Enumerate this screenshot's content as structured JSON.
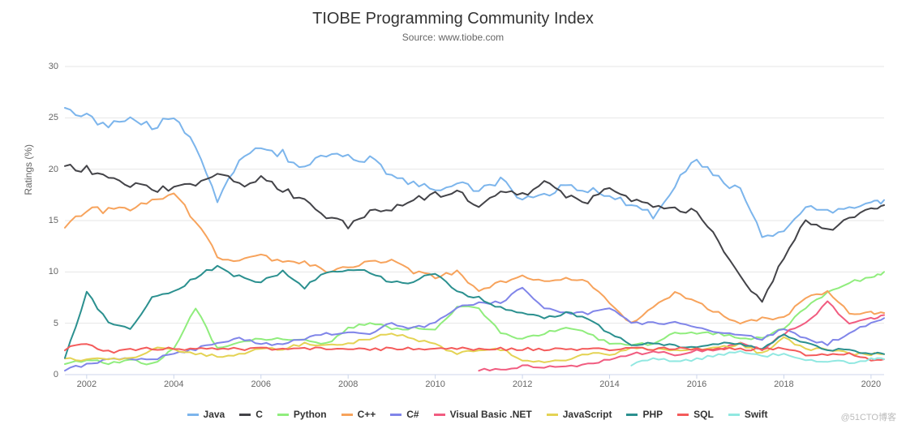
{
  "chart_data": {
    "type": "line",
    "title": "TIOBE Programming Community Index",
    "subtitle": "Source: www.tiobe.com",
    "ylabel": "Ratings (%)",
    "xlabel": "",
    "ylim": [
      0,
      30
    ],
    "yticks": [
      0,
      5,
      10,
      15,
      20,
      25,
      30
    ],
    "xrange": [
      2001.5,
      2020.3
    ],
    "xticks": [
      2002,
      2004,
      2006,
      2008,
      2010,
      2012,
      2014,
      2016,
      2018,
      2020
    ],
    "x": [
      2001.5,
      2002,
      2002.5,
      2003,
      2003.5,
      2004,
      2004.5,
      2005,
      2005.5,
      2006,
      2006.5,
      2007,
      2007.5,
      2008,
      2008.5,
      2009,
      2009.5,
      2010,
      2010.5,
      2011,
      2011.5,
      2012,
      2012.5,
      2013,
      2013.5,
      2014,
      2014.5,
      2015,
      2015.5,
      2016,
      2016.5,
      2017,
      2017.5,
      2018,
      2018.5,
      2019,
      2019.5,
      2020,
      2020.3
    ],
    "series": [
      {
        "name": "Java",
        "color": "#7cb5ec",
        "values": [
          26.5,
          25.0,
          24.5,
          25.0,
          24.0,
          25.0,
          22.0,
          17.0,
          21.0,
          22.0,
          21.5,
          20.0,
          21.5,
          21.0,
          21.0,
          19.5,
          18.5,
          18.0,
          18.5,
          18.0,
          19.0,
          17.0,
          17.5,
          18.5,
          18.0,
          17.5,
          16.5,
          15.5,
          18.5,
          21.0,
          19.0,
          18.0,
          13.5,
          14.0,
          16.5,
          16.0,
          16.0,
          16.5,
          17.0
        ]
      },
      {
        "name": "C",
        "color": "#434348",
        "values": [
          20.5,
          20.0,
          19.5,
          18.5,
          18.0,
          18.0,
          18.5,
          19.5,
          18.5,
          19.0,
          18.0,
          17.0,
          15.5,
          14.5,
          16.0,
          16.0,
          17.0,
          17.5,
          18.0,
          16.0,
          18.0,
          17.5,
          18.5,
          17.5,
          17.0,
          18.0,
          17.0,
          16.5,
          16.0,
          16.0,
          13.0,
          9.5,
          7.0,
          11.5,
          15.0,
          14.0,
          15.5,
          16.0,
          16.5
        ]
      },
      {
        "name": "Python",
        "color": "#90ed7d",
        "values": [
          1.0,
          1.5,
          1.0,
          1.5,
          1.0,
          2.5,
          6.5,
          2.5,
          3.0,
          3.5,
          3.5,
          3.5,
          3.0,
          4.5,
          5.0,
          4.5,
          4.5,
          4.5,
          6.5,
          6.5,
          4.0,
          3.5,
          4.0,
          4.5,
          4.0,
          3.0,
          3.0,
          3.0,
          4.0,
          4.0,
          4.0,
          3.5,
          3.5,
          4.5,
          6.5,
          8.0,
          9.0,
          9.5,
          10.0
        ]
      },
      {
        "name": "C++",
        "color": "#f7a35c",
        "values": [
          14.5,
          16.0,
          16.0,
          16.0,
          17.0,
          17.5,
          15.0,
          11.5,
          11.0,
          11.5,
          11.0,
          11.0,
          10.0,
          10.5,
          11.0,
          11.0,
          10.0,
          9.5,
          10.0,
          8.0,
          9.0,
          9.5,
          9.0,
          9.5,
          9.0,
          7.0,
          5.0,
          6.5,
          8.0,
          7.0,
          6.0,
          5.0,
          5.5,
          5.5,
          7.5,
          8.0,
          6.0,
          6.0,
          6.0
        ]
      },
      {
        "name": "C#",
        "color": "#8085e9",
        "values": [
          0.5,
          1.0,
          1.5,
          1.5,
          1.5,
          2.0,
          2.5,
          3.0,
          3.5,
          3.0,
          3.0,
          3.5,
          4.0,
          4.0,
          4.0,
          5.0,
          4.5,
          5.0,
          6.5,
          7.0,
          7.0,
          8.5,
          6.5,
          6.0,
          6.0,
          6.5,
          5.0,
          5.0,
          5.0,
          4.5,
          4.0,
          4.0,
          3.5,
          4.5,
          3.5,
          3.0,
          4.0,
          5.0,
          5.5
        ]
      },
      {
        "name": "Visual Basic .NET",
        "color": "#f15c80",
        "values": [
          null,
          null,
          null,
          null,
          null,
          null,
          null,
          null,
          null,
          null,
          null,
          null,
          null,
          null,
          null,
          null,
          null,
          null,
          null,
          0.5,
          0.5,
          0.8,
          0.7,
          0.8,
          1.0,
          1.5,
          2.0,
          2.2,
          2.0,
          2.3,
          2.5,
          3.0,
          2.5,
          4.0,
          5.0,
          7.0,
          5.0,
          5.5,
          5.8
        ]
      },
      {
        "name": "JavaScript",
        "color": "#e4d354",
        "values": [
          1.5,
          1.5,
          1.5,
          1.5,
          2.5,
          2.5,
          2.0,
          1.8,
          2.0,
          2.5,
          2.5,
          3.0,
          2.8,
          3.0,
          3.5,
          4.0,
          3.5,
          3.0,
          2.0,
          2.5,
          2.5,
          1.5,
          1.2,
          1.5,
          2.0,
          2.0,
          2.5,
          2.5,
          2.3,
          2.5,
          2.6,
          3.0,
          2.0,
          3.5,
          2.5,
          2.5,
          2.0,
          2.0,
          2.0
        ]
      },
      {
        "name": "PHP",
        "color": "#2b908f",
        "values": [
          1.5,
          8.0,
          5.0,
          4.5,
          7.5,
          8.0,
          9.5,
          10.5,
          9.5,
          9.0,
          10.0,
          8.5,
          10.0,
          10.0,
          10.0,
          9.0,
          9.0,
          10.0,
          8.0,
          7.5,
          6.5,
          6.0,
          5.5,
          6.0,
          5.5,
          4.0,
          3.0,
          3.0,
          2.8,
          2.7,
          3.0,
          3.0,
          2.5,
          4.0,
          3.0,
          2.5,
          2.3,
          2.0,
          2.0
        ]
      },
      {
        "name": "SQL",
        "color": "#f45b5b",
        "values": [
          2.5,
          3.0,
          2.2,
          2.5,
          2.5,
          2.5,
          2.5,
          2.5,
          2.5,
          2.5,
          2.5,
          2.5,
          2.5,
          2.5,
          2.5,
          2.5,
          2.5,
          2.5,
          2.5,
          2.5,
          2.5,
          2.5,
          2.5,
          2.5,
          2.5,
          2.5,
          2.5,
          2.5,
          2.5,
          2.5,
          2.5,
          2.5,
          2.5,
          2.5,
          2.0,
          2.0,
          2.0,
          1.5,
          1.5
        ]
      },
      {
        "name": "Swift",
        "color": "#91e8e1",
        "values": [
          null,
          null,
          null,
          null,
          null,
          null,
          null,
          null,
          null,
          null,
          null,
          null,
          null,
          null,
          null,
          null,
          null,
          null,
          null,
          null,
          null,
          null,
          null,
          null,
          null,
          null,
          1.0,
          1.5,
          1.3,
          1.5,
          2.0,
          2.2,
          1.8,
          2.0,
          1.5,
          1.3,
          1.2,
          1.5,
          1.5
        ]
      }
    ]
  },
  "watermark": "@51CTO博客"
}
